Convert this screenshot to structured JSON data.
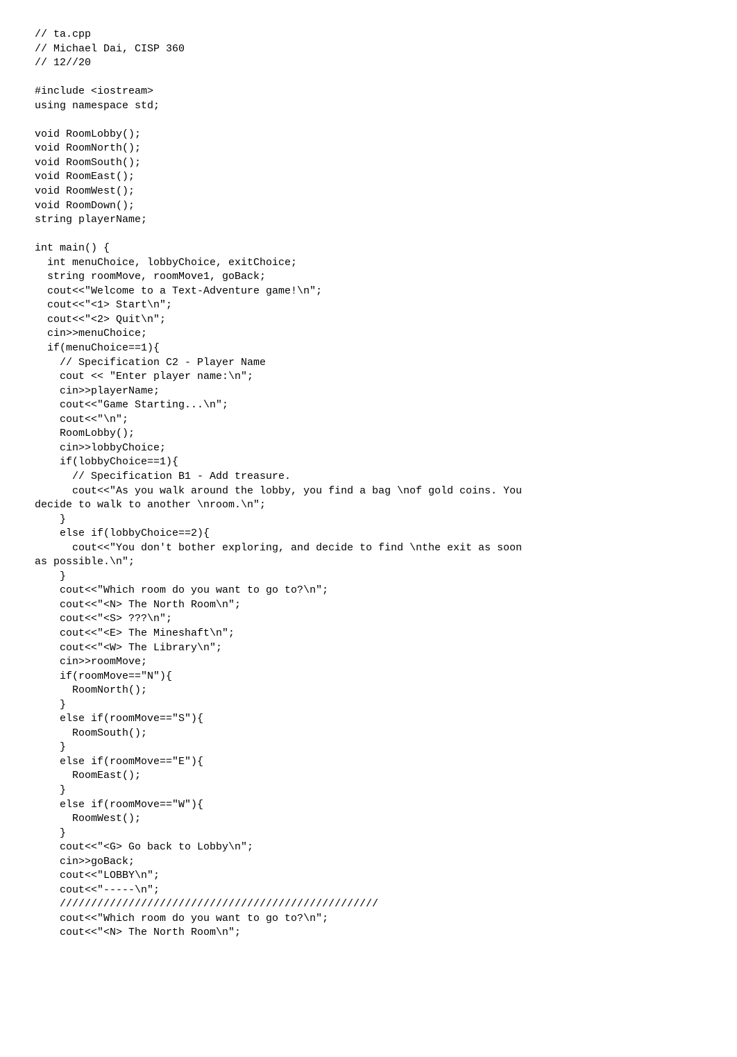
{
  "code_lines": [
    "// ta.cpp",
    "// Michael Dai, CISP 360",
    "// 12//20",
    "",
    "#include <iostream>",
    "using namespace std;",
    "",
    "void RoomLobby();",
    "void RoomNorth();",
    "void RoomSouth();",
    "void RoomEast();",
    "void RoomWest();",
    "void RoomDown();",
    "string playerName;",
    "",
    "int main() {",
    "  int menuChoice, lobbyChoice, exitChoice;",
    "  string roomMove, roomMove1, goBack;",
    "  cout<<\"Welcome to a Text-Adventure game!\\n\";",
    "  cout<<\"<1> Start\\n\";",
    "  cout<<\"<2> Quit\\n\";",
    "  cin>>menuChoice;",
    "  if(menuChoice==1){",
    "    // Specification C2 - Player Name",
    "    cout << \"Enter player name:\\n\";",
    "    cin>>playerName;",
    "    cout<<\"Game Starting...\\n\";",
    "    cout<<\"\\n\";",
    "    RoomLobby();",
    "    cin>>lobbyChoice;",
    "    if(lobbyChoice==1){",
    "      // Specification B1 - Add treasure.",
    "      cout<<\"As you walk around the lobby, you find a bag \\nof gold coins. You ",
    "decide to walk to another \\nroom.\\n\";",
    "    }",
    "    else if(lobbyChoice==2){",
    "      cout<<\"You don't bother exploring, and decide to find \\nthe exit as soon ",
    "as possible.\\n\";",
    "    }",
    "    cout<<\"Which room do you want to go to?\\n\";",
    "    cout<<\"<N> The North Room\\n\";",
    "    cout<<\"<S> ???\\n\";",
    "    cout<<\"<E> The Mineshaft\\n\";",
    "    cout<<\"<W> The Library\\n\";",
    "    cin>>roomMove;",
    "    if(roomMove==\"N\"){",
    "      RoomNorth();",
    "    }",
    "    else if(roomMove==\"S\"){",
    "      RoomSouth();",
    "    }",
    "    else if(roomMove==\"E\"){",
    "      RoomEast();",
    "    }",
    "    else if(roomMove==\"W\"){",
    "      RoomWest();",
    "    }",
    "    cout<<\"<G> Go back to Lobby\\n\";",
    "    cin>>goBack;",
    "    cout<<\"LOBBY\\n\";",
    "    cout<<\"-----\\n\";",
    "    ///////////////////////////////////////////////////",
    "    cout<<\"Which room do you want to go to?\\n\";",
    "    cout<<\"<N> The North Room\\n\";"
  ]
}
